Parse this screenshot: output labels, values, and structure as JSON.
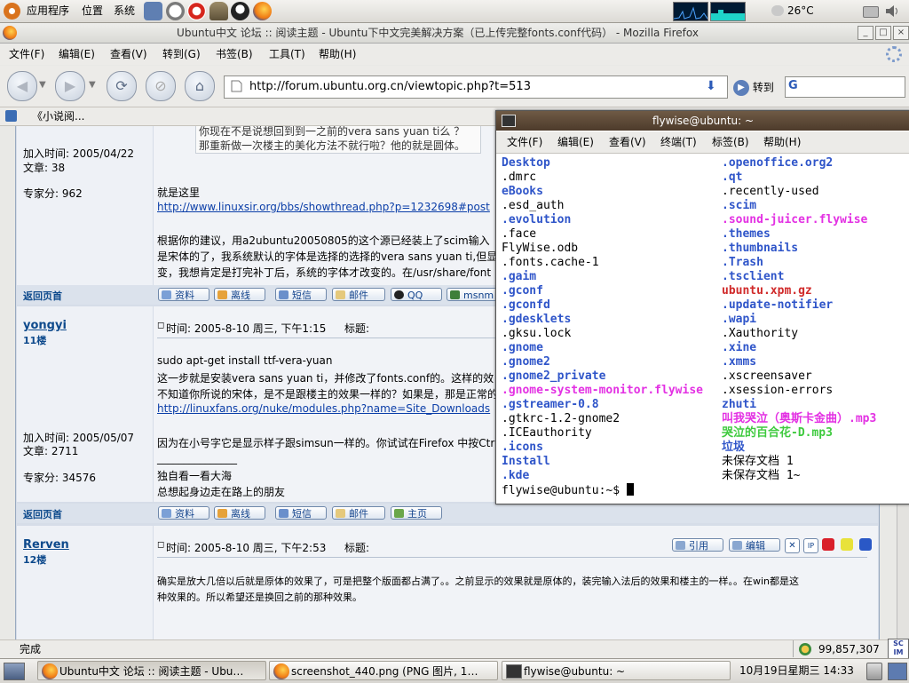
{
  "top_panel": {
    "menus": [
      "应用程序",
      "位置",
      "系统"
    ],
    "launchers": [
      "ubuntu-logo-icon",
      "gnome-icon",
      "clock-app-icon",
      "help-icon",
      "gimp-icon",
      "qq-icon",
      "firefox-icon"
    ],
    "weather": "26°C"
  },
  "firefox": {
    "title": "Ubuntu中文 论坛 :: 阅读主题 - Ubuntu下中文完美解决方案（已上传完整fonts.conf代码） - Mozilla Firefox",
    "menu": [
      "文件(F)",
      "编辑(E)",
      "查看(V)",
      "转到(G)",
      "书签(B)",
      "工具(T)",
      "帮助(H)"
    ],
    "url": "http://forum.ubuntu.org.cn/viewtopic.php?t=513",
    "go_label": "转到",
    "search_engine": "G",
    "bookmark": "《小说阅...",
    "status": "完成",
    "counter": "99,857,307"
  },
  "forum": {
    "quote_lines": [
      "你现在不是说想回到到一之前的vera sans yuan ti么  ？",
      "那重新做一次楼主的美化方法不就行啦？他的就是圆体。"
    ],
    "posts": [
      {
        "joined": "加入时间: 2005/04/22",
        "articles": "文章: 38",
        "score": "专家分: 962",
        "body": [
          "就是这里",
          "http://www.linuxsir.org/bbs/showthread.php?p=1232698#post",
          "",
          "根据你的建议，用a2ubuntu20050805的这个源已经装上了scim输入",
          "是宋体的了，我系统默认的字体是选择的选择的vera sans yuan ti,但显",
          "变，我想肯定是打完补丁后，系统的字体才改变的。在/usr/share/font"
        ],
        "link_line": 1,
        "buttons": [
          "资料",
          "离线",
          "短信",
          "邮件",
          "QQ",
          "msnm"
        ]
      },
      {
        "user": "yongyi",
        "floor": "11楼",
        "time": "时间: 2005-8-10 周三, 下午1:15",
        "subject": "标题:",
        "joined": "加入时间: 2005/05/07",
        "articles": "文章: 2711",
        "score": "专家分: 34576",
        "body": [
          "sudo apt-get install ttf-vera-yuan",
          "这一步就是安装vera sans yuan ti，并修改了fonts.conf的。这样的效",
          "不知道你所说的宋体，是不是跟楼主的效果一样的？如果是，那是正常的",
          "http://linuxfans.org/nuke/modules.php?name=Site_Downloads",
          "",
          "因为在小号字它是显示样子跟simsun一样的。你试试在Firefox 中按Ctr",
          "",
          "_______________",
          "独自看一看大海",
          "总想起身边走在路上的朋友"
        ],
        "link_line": 3,
        "buttons": [
          "资料",
          "离线",
          "短信",
          "邮件",
          "主页"
        ]
      },
      {
        "user": "Rerven",
        "floor": "12楼",
        "time": "时间: 2005-8-10 周三, 下午2:53",
        "subject": "标题:",
        "actions": [
          "引用",
          "编辑"
        ],
        "body": [
          "确实是放大几倍以后就是原体的效果了，可是把整个版面都占满了。。之前显示的效果就是原体的，装完输入法后的效果和楼主的一样。。在win都是这",
          "种效果的。所以希望还是换回之前的那种效果。"
        ]
      }
    ],
    "back_to_top": "返回页首"
  },
  "terminal": {
    "title": "flywise@ubuntu: ~",
    "menu": [
      "文件(F)",
      "编辑(E)",
      "查看(V)",
      "终端(T)",
      "标签(B)",
      "帮助(H)"
    ],
    "left": [
      {
        "t": "Desktop",
        "c": "blue"
      },
      {
        "t": ".dmrc",
        "c": "black"
      },
      {
        "t": "eBooks",
        "c": "blue"
      },
      {
        "t": ".esd_auth",
        "c": "black"
      },
      {
        "t": ".evolution",
        "c": "blue"
      },
      {
        "t": ".face",
        "c": "black"
      },
      {
        "t": "FlyWise.odb",
        "c": "black"
      },
      {
        "t": ".fonts.cache-1",
        "c": "black"
      },
      {
        "t": ".gaim",
        "c": "blue"
      },
      {
        "t": ".gconf",
        "c": "blue"
      },
      {
        "t": ".gconfd",
        "c": "blue"
      },
      {
        "t": ".gdesklets",
        "c": "blue"
      },
      {
        "t": ".gksu.lock",
        "c": "black"
      },
      {
        "t": ".gnome",
        "c": "blue"
      },
      {
        "t": ".gnome2",
        "c": "blue"
      },
      {
        "t": ".gnome2_private",
        "c": "blue"
      },
      {
        "t": ".gnome-system-monitor.flywise",
        "c": "mag"
      },
      {
        "t": ".gstreamer-0.8",
        "c": "blue"
      },
      {
        "t": ".gtkrc-1.2-gnome2",
        "c": "black"
      },
      {
        "t": ".ICEauthority",
        "c": "black"
      },
      {
        "t": ".icons",
        "c": "blue"
      },
      {
        "t": "Install",
        "c": "blue"
      },
      {
        "t": ".kde",
        "c": "blue"
      }
    ],
    "right": [
      {
        "t": ".openoffice.org2",
        "c": "blue"
      },
      {
        "t": ".qt",
        "c": "blue"
      },
      {
        "t": ".recently-used",
        "c": "black"
      },
      {
        "t": ".scim",
        "c": "blue"
      },
      {
        "t": ".sound-juicer.flywise",
        "c": "mag"
      },
      {
        "t": ".themes",
        "c": "blue"
      },
      {
        "t": ".thumbnails",
        "c": "blue"
      },
      {
        "t": ".Trash",
        "c": "blue"
      },
      {
        "t": ".tsclient",
        "c": "blue"
      },
      {
        "t": "ubuntu.xpm.gz",
        "c": "red"
      },
      {
        "t": ".update-notifier",
        "c": "blue"
      },
      {
        "t": ".wapi",
        "c": "blue"
      },
      {
        "t": ".Xauthority",
        "c": "black"
      },
      {
        "t": ".xine",
        "c": "blue"
      },
      {
        "t": ".xmms",
        "c": "blue"
      },
      {
        "t": ".xscreensaver",
        "c": "black"
      },
      {
        "t": ".xsession-errors",
        "c": "black"
      },
      {
        "t": "zhuti",
        "c": "blue"
      },
      {
        "t": "叫我哭泣（奥斯卡金曲）.mp3",
        "c": "mag"
      },
      {
        "t": "哭泣的百合花-D.mp3",
        "c": "green"
      },
      {
        "t": "垃圾",
        "c": "blue"
      },
      {
        "t": "未保存文档 1",
        "c": "black"
      },
      {
        "t": "未保存文档 1~",
        "c": "black"
      }
    ],
    "prompt": "flywise@ubuntu:~$ "
  },
  "taskbar": {
    "tasks": [
      "Ubuntu中文 论坛 :: 阅读主题 - Ubu…",
      "screenshot_440.png (PNG 图片, 1…",
      "flywise@ubuntu: ~"
    ],
    "clock": "10月19日星期三 14:33"
  },
  "colors": {
    "blue_dir": "#2f55c9",
    "magenta": "#e331e3",
    "red": "#d02a2a",
    "green": "#3fca3f",
    "link": "#0b3ea8"
  }
}
